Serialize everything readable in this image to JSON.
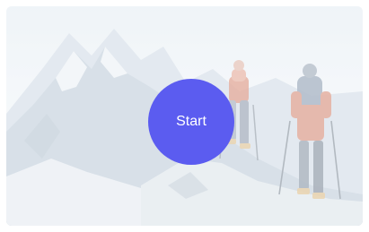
{
  "background": {
    "description_icon": "mountain-hikers-image"
  },
  "start_button": {
    "label": "Start",
    "color": "#5b5cf0",
    "text_color": "#ffffff"
  }
}
